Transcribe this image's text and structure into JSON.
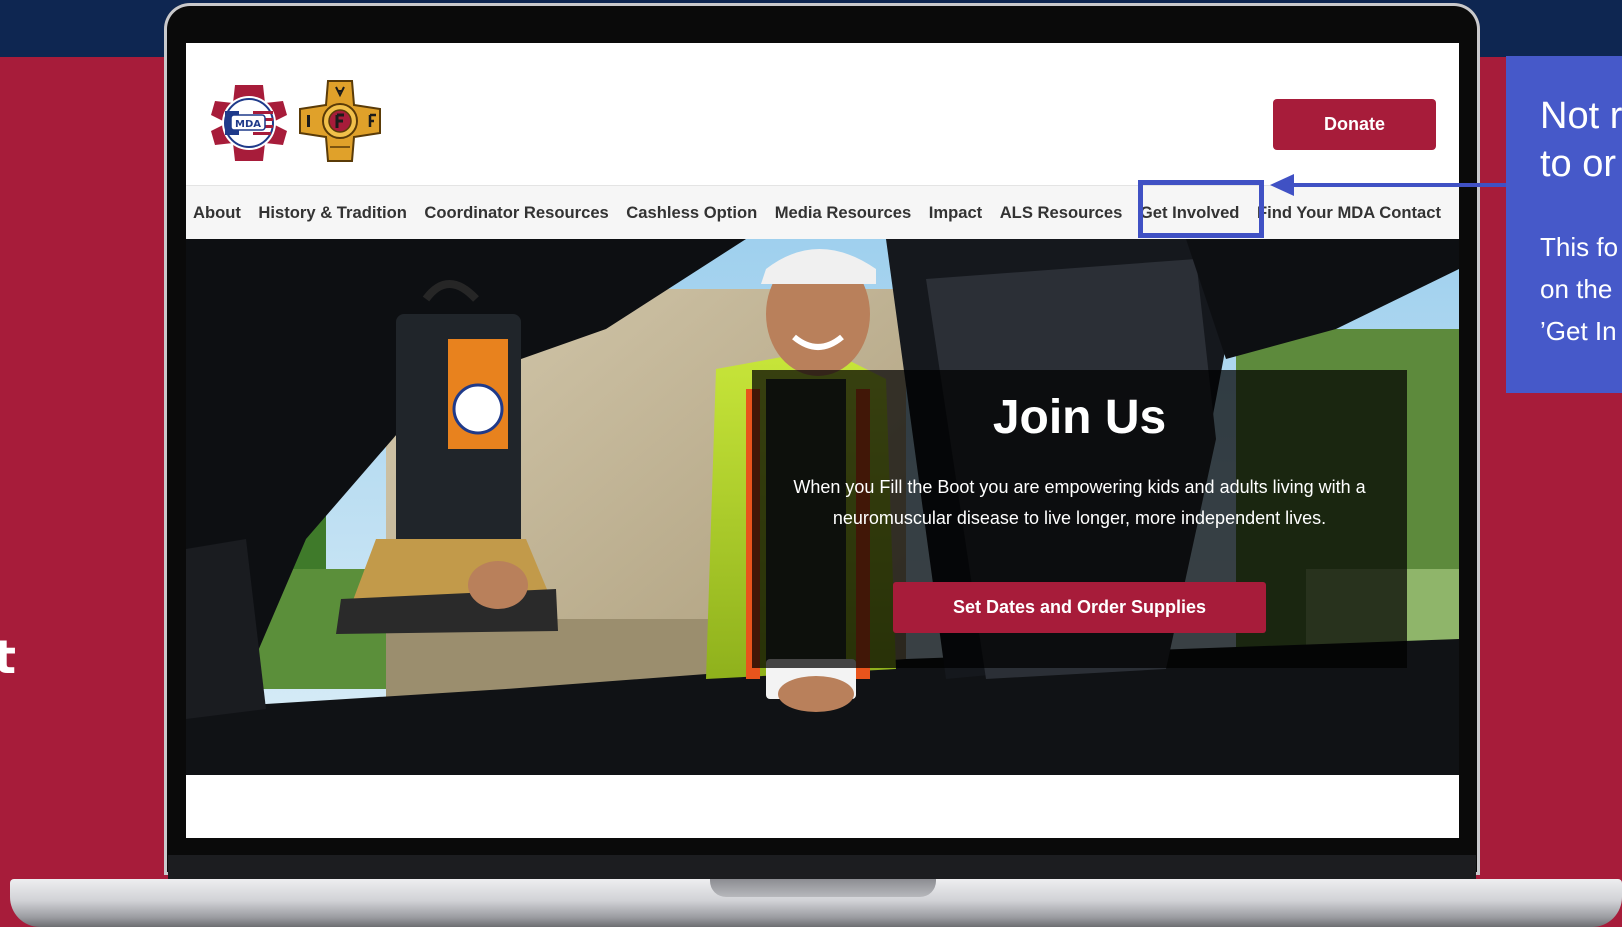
{
  "slide": {
    "side_text": "t",
    "callout": {
      "title": "Not r\nto or",
      "body": "This fo\non the\n’Get In"
    }
  },
  "site": {
    "donate_label": "Donate",
    "nav": [
      "About",
      "History & Tradition",
      "Coordinator Resources",
      "Cashless Option",
      "Media Resources",
      "Impact",
      "ALS Resources",
      "Get Involved",
      "Find Your MDA Contact"
    ],
    "hero": {
      "title": "Join Us",
      "text": "When you Fill the Boot you are empowering kids and adults living with a neuromuscular disease to live longer, more independent lives.",
      "cta_label": "Set Dates and Order Supplies"
    }
  },
  "colors": {
    "brand_red": "#a71c3a",
    "navy": "#0e2651",
    "callout_blue": "#4659c9",
    "highlight_blue": "#4051c4"
  },
  "icons": [
    "mda-fill-the-boot-logo",
    "iaff-logo",
    "arrow-left-icon"
  ]
}
